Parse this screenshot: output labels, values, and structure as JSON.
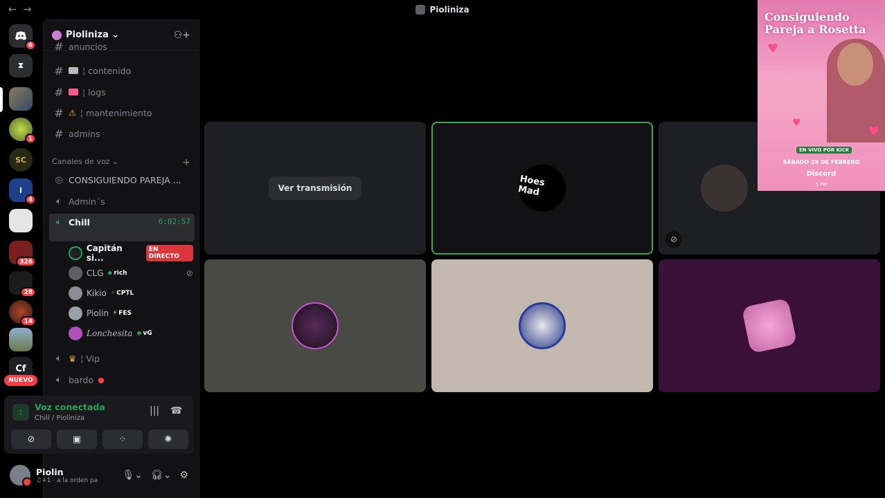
{
  "window": {
    "title": "Pioliniza"
  },
  "rail": {
    "badges": [
      "6",
      "1",
      "4",
      "326",
      "28",
      "14"
    ],
    "nuevo_label": "NUEVO",
    "cf_label": "Cf"
  },
  "server": {
    "name": "Pioliniza ⌄"
  },
  "channels": {
    "text": [
      {
        "label": "anuncios"
      },
      {
        "label": "¦ contenido"
      },
      {
        "label": "¦ logs"
      },
      {
        "label": "¦ mantenimiento"
      },
      {
        "label": "admins"
      }
    ],
    "voice_category": "Canales de voz ⌄",
    "voice": [
      {
        "label": "CONSIGUIENDO PAREJA ..."
      },
      {
        "label": "Admin´s"
      },
      {
        "label": "Chill",
        "timer": "6:02:57"
      },
      {
        "label": "¦ Vip"
      },
      {
        "label": "bardo"
      }
    ]
  },
  "voice_users": [
    {
      "name": "Capitán si...",
      "live": "EN DIRECTO"
    },
    {
      "name": "CLG",
      "tag": "rich"
    },
    {
      "name": "Kikio",
      "tag": "CPTL"
    },
    {
      "name": "Piolin",
      "tag": "FES"
    },
    {
      "name": "Lonchesita",
      "tag": "vG"
    }
  ],
  "voice_panel": {
    "title": "Voz conectada",
    "subtitle": "Chill / Pioliniza"
  },
  "user_panel": {
    "name": "Piolin",
    "status": "♫+1 · a la orden pa"
  },
  "stage": {
    "watch_label": "Ver transmisión",
    "hoes_mad_text": "Hoes Mad"
  },
  "poster": {
    "title": "Consiguiendo Pareja a Rosetta",
    "live_on": "EN VIVO POR KICK",
    "date": "SÁBADO 28 DE FEBRERO",
    "platform": "Discord",
    "time": "5 PM"
  },
  "colors": {
    "accent_green": "#23a55a",
    "badge_red": "#f23f43",
    "sidebar_bg": "#121214"
  }
}
